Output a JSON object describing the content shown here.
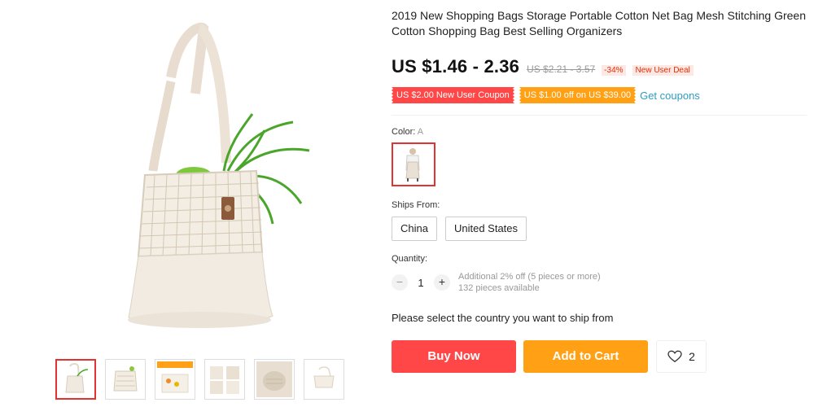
{
  "product": {
    "title": "2019 New Shopping Bags Storage Portable Cotton Net Bag Mesh Stitching Green Cotton Shopping Bag Best Selling Organizers"
  },
  "gallery": {
    "main_image_icon": "cotton-mesh-bag-with-vegetables",
    "thumbnails": [
      {
        "icon": "bag-thumb-1",
        "selected": true
      },
      {
        "icon": "bag-thumb-2",
        "selected": false
      },
      {
        "icon": "bag-thumb-3",
        "selected": false
      },
      {
        "icon": "bag-thumb-4",
        "selected": false
      },
      {
        "icon": "bag-thumb-5",
        "selected": false
      },
      {
        "icon": "bag-thumb-6",
        "selected": false
      }
    ]
  },
  "pricing": {
    "current": "US $1.46 - 2.36",
    "original": "US $2.21 - 3.57",
    "discount": "-34%",
    "deal_badge": "New User Deal"
  },
  "coupons": {
    "new_user": "US $2.00 New User Coupon",
    "store": "US $1.00 off on US $39.00",
    "get_link": "Get coupons"
  },
  "color": {
    "label": "Color:",
    "value": "A"
  },
  "shipping": {
    "label": "Ships From:",
    "options": [
      "China",
      "United States"
    ],
    "message": "Please select the country you want to ship from"
  },
  "quantity": {
    "label": "Quantity:",
    "minus": "−",
    "plus": "+",
    "value": "1",
    "note_discount": "Additional 2% off (5 pieces or more)",
    "note_available": "132 pieces available"
  },
  "actions": {
    "buy_now": "Buy Now",
    "add_to_cart": "Add to Cart",
    "wishlist_count": "2"
  },
  "colors": {
    "accent_red": "#ff4747",
    "accent_orange": "#ffa015",
    "link_blue": "#2e9cc3"
  }
}
